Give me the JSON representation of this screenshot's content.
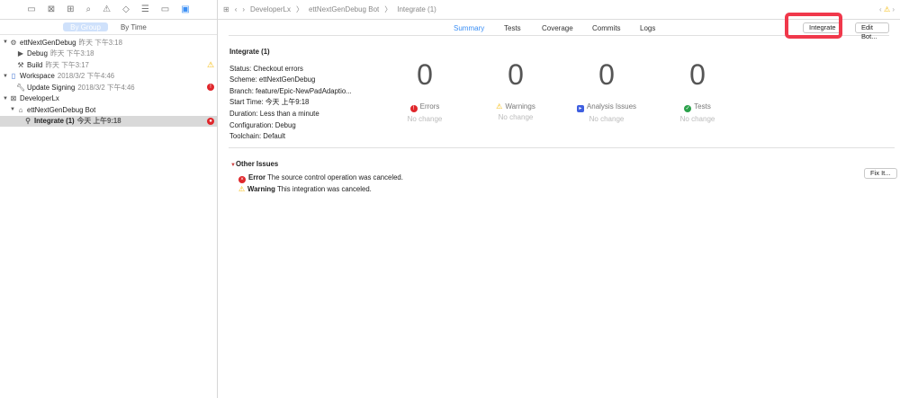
{
  "sidebar": {
    "nav_icons": [
      "folder-icon",
      "source-control-icon",
      "hierarchy-icon",
      "search-icon",
      "warning-icon",
      "test-icon",
      "debug-icon",
      "breakpoint-icon",
      "report-icon"
    ],
    "segments": [
      "By Group",
      "By Time"
    ],
    "items": [
      {
        "label": "ettNextGenDebug",
        "date": "昨天 下午3:18"
      },
      {
        "label": "Debug",
        "date": "昨天 下午3:18"
      },
      {
        "label": "Build",
        "date": "昨天 下午3:17"
      },
      {
        "label": "Workspace",
        "date": "2018/3/2 下午4:46"
      },
      {
        "label": "Update Signing",
        "date": "2018/3/2 下午4:46"
      },
      {
        "label": "DeveloperLx",
        "date": ""
      },
      {
        "label": "ettNextGenDebug Bot",
        "date": ""
      },
      {
        "label": "Integrate (1)",
        "date": "今天 上午9:18"
      }
    ]
  },
  "breadcrumb": [
    "DeveloperLx",
    "ettNextGenDebug Bot",
    "Integrate (1)"
  ],
  "tabs": [
    "Summary",
    "Tests",
    "Coverage",
    "Commits",
    "Logs"
  ],
  "buttons": {
    "integrate": "Integrate",
    "edit_bot": "Edit Bot...",
    "fix_it": "Fix It..."
  },
  "summary": {
    "title": "Integrate (1)",
    "lines": [
      "Status: Checkout errors",
      "Scheme: ettNextGenDebug",
      "Branch: feature/Epic-NewPadAdaptio...",
      "Start Time: 今天 上午9:18",
      "Duration: Less than a minute",
      "Configuration: Debug",
      "Toolchain: Default"
    ]
  },
  "stats": [
    {
      "value": "0",
      "label": "Errors",
      "change": "No change",
      "color": "#e0262b"
    },
    {
      "value": "0",
      "label": "Warnings",
      "change": "No change",
      "color": "#f5b800"
    },
    {
      "value": "0",
      "label": "Analysis Issues",
      "change": "No change",
      "color": "#3f5fe0"
    },
    {
      "value": "0",
      "label": "Tests",
      "change": "No change",
      "color": "#2aa14a"
    }
  ],
  "other_issues": {
    "title": "Other Issues",
    "items": [
      {
        "kind": "Error",
        "text": "The source control operation was canceled."
      },
      {
        "kind": "Warning",
        "text": "This integration was canceled."
      }
    ]
  },
  "colors": {
    "accent": "#3b8ff5",
    "highlight": "#f0384b"
  }
}
